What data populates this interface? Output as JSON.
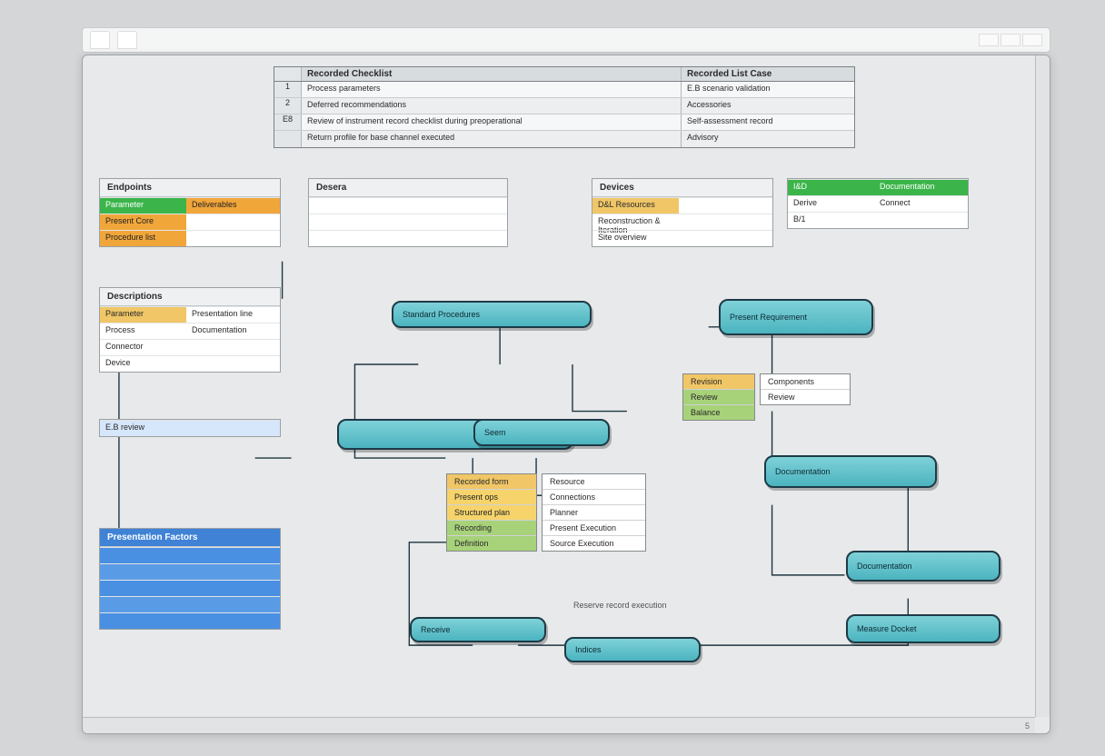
{
  "titlebar": {
    "tab_a": "",
    "tab_b": ""
  },
  "summary": {
    "headers": {
      "idx": "",
      "name": "Recorded Checklist",
      "status": "Recorded List Case"
    },
    "rows": [
      {
        "idx": "1",
        "name": "Process parameters",
        "status": "E.B scenario validation"
      },
      {
        "idx": "2",
        "name": "Deferred recommendations",
        "status": "Accessories"
      },
      {
        "idx": "E8",
        "name": "Review of instrument record checklist during preoperational",
        "status": "Self-assessment record"
      },
      {
        "idx": "",
        "name": "Return profile for base channel executed",
        "status": "Advisory"
      }
    ]
  },
  "left_panels": {
    "panel1": {
      "title": "Endpoints",
      "rows": [
        {
          "k": "Parameter",
          "v": "Deliverables",
          "kc": "sw-green",
          "vc": "sw-orange"
        },
        {
          "k": "Present Core",
          "v": "",
          "kc": "sw-orange"
        },
        {
          "k": "Procedure list",
          "v": "",
          "kc": "sw-orange"
        }
      ]
    },
    "panel2": {
      "title": "Descriptions",
      "rows": [
        {
          "k": "Parameter",
          "v": "Presentation line",
          "kc": "sw-head"
        },
        {
          "k": "Process",
          "v": "Documentation"
        },
        {
          "k": "Connector",
          "v": ""
        },
        {
          "k": "Device",
          "v": ""
        }
      ]
    },
    "panel3": {
      "title": "",
      "rows": [
        {
          "k": "E.B review",
          "v": ""
        }
      ]
    },
    "panel4": {
      "title": "Presentation Factors",
      "rows": [
        {
          "k": "",
          "v": ""
        },
        {
          "k": "",
          "v": ""
        },
        {
          "k": "",
          "v": ""
        },
        {
          "k": "",
          "v": ""
        },
        {
          "k": "",
          "v": ""
        }
      ]
    }
  },
  "center_panel": {
    "title": "Desera",
    "rows": [
      {
        "k": "",
        "v": ""
      },
      {
        "k": "",
        "v": ""
      },
      {
        "k": "",
        "v": ""
      }
    ]
  },
  "right_panels": {
    "panel1": {
      "title": "Devices",
      "rows": [
        {
          "k": "D&L Resources",
          "v": "",
          "kc": "sw-head"
        },
        {
          "k": "Reconstruction & Iteration",
          "v": ""
        },
        {
          "k": "Site overview",
          "v": ""
        }
      ]
    },
    "panel2": {
      "title": "",
      "rows": [
        {
          "k": "I&D",
          "v": "Documentation",
          "kc": "sw-green"
        },
        {
          "k": "Derive",
          "v": "Connect"
        },
        {
          "k": "B/1",
          "v": ""
        }
      ]
    }
  },
  "nodes": {
    "n1": "Standard Procedures",
    "n2": "",
    "n3": "Seem",
    "n4": "Receive",
    "n5": "Indices",
    "n6": "Present Requirement",
    "n7": "Documentation",
    "n8": "Documentation",
    "n9": "Measure Docket"
  },
  "tag_mid_left": {
    "items": [
      "Recorded form",
      "Present ops",
      "Structured plan",
      "Recording",
      "Definition"
    ]
  },
  "tag_mid_right": {
    "items": [
      "Resource",
      "Connections",
      "Planner",
      "Present Execution",
      "Source Execution"
    ]
  },
  "tag_r1": {
    "items": [
      "Revision",
      "Review",
      "Balance"
    ],
    "colors": [
      "sw-head",
      "sw-lime",
      "sw-lime"
    ]
  },
  "tag_r2": {
    "items": [
      "Components",
      "Review"
    ]
  },
  "footer_note": "Reserve record execution",
  "status": {
    "left": "",
    "right": "5"
  }
}
